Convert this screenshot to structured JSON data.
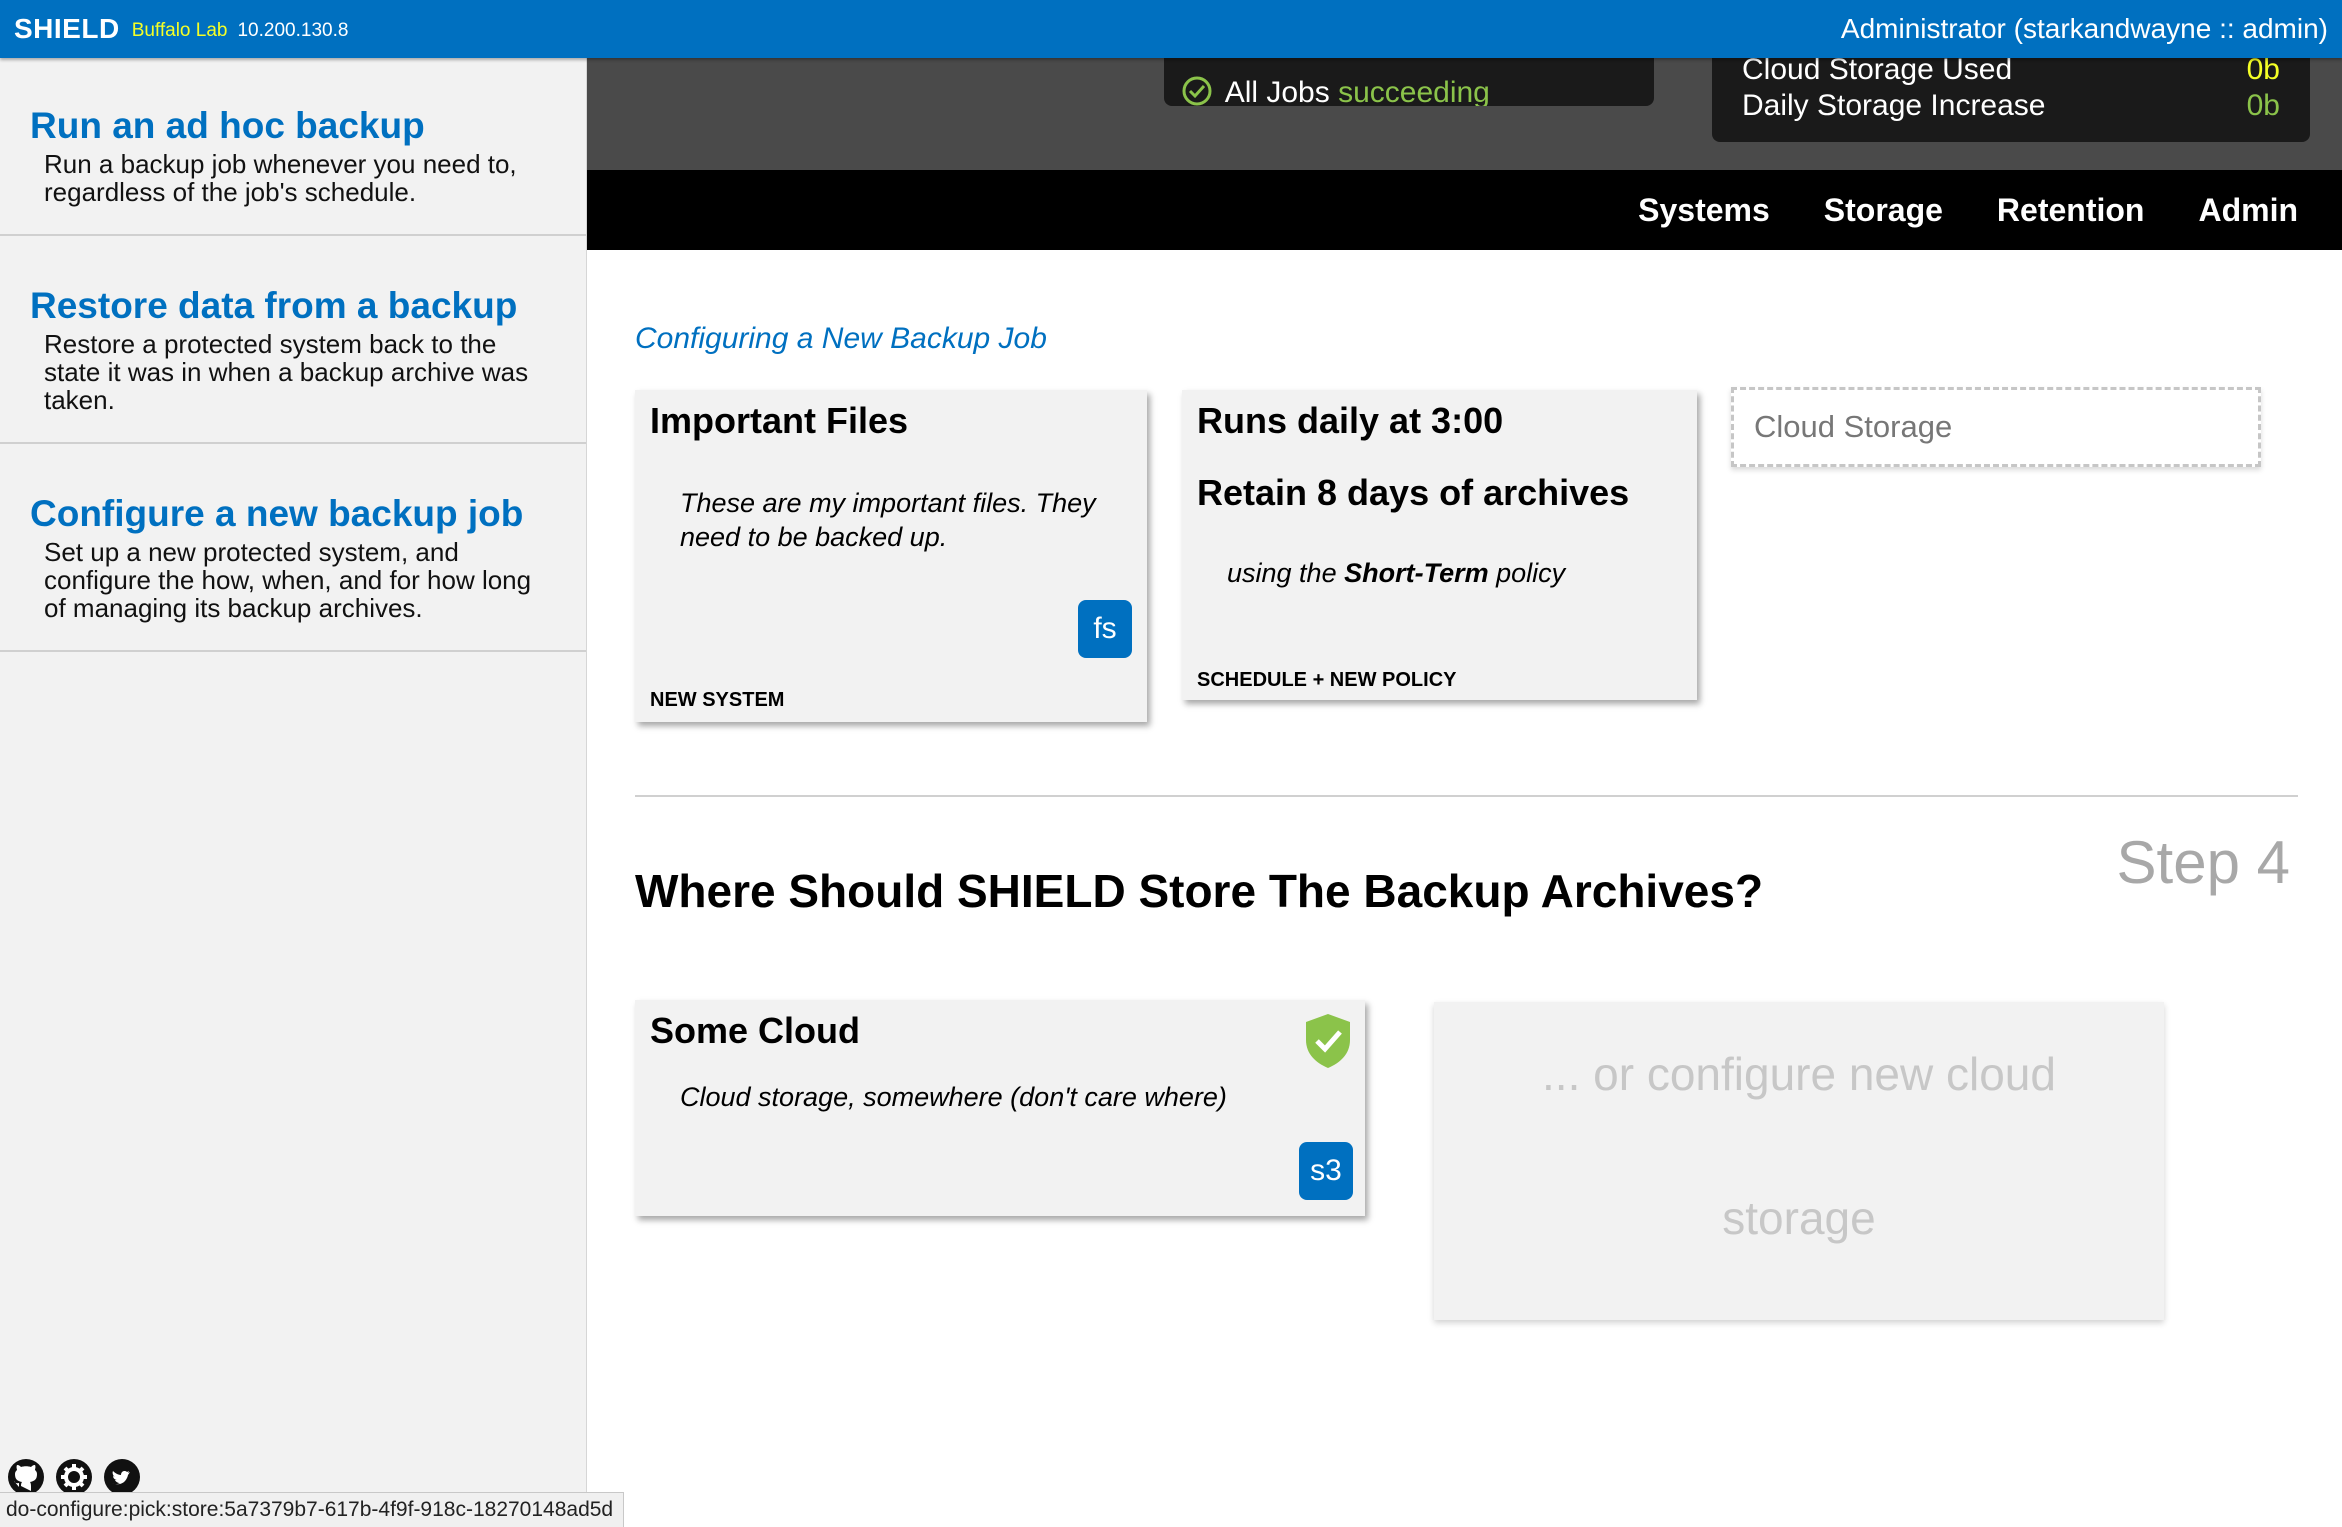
{
  "topbar": {
    "brand": "SHIELD",
    "env": "Buffalo Lab",
    "ip": "10.200.130.8",
    "user": "Administrator (starkandwayne :: admin)"
  },
  "sidebar": {
    "items": [
      {
        "title": "Run an ad hoc backup",
        "desc": "Run a backup job whenever you need to, regardless of the job's schedule."
      },
      {
        "title": "Restore data from a backup",
        "desc": "Restore a protected system back to the state it was in when a backup archive was taken."
      },
      {
        "title": "Configure a new backup job",
        "desc": "Set up a new protected system, and configure the how, when, and for how long of managing its backup archives."
      }
    ],
    "footer_icons": [
      "github-icon",
      "gear-icon",
      "twitter-icon"
    ]
  },
  "dashboard": {
    "jobs_label": "All Jobs",
    "jobs_status": "succeeding",
    "cloud_used_label": "Cloud Storage Used",
    "cloud_used_value": "0b",
    "daily_increase_label": "Daily Storage Increase",
    "daily_increase_value": "0b"
  },
  "nav": {
    "items": [
      "Systems",
      "Storage",
      "Retention",
      "Admin"
    ]
  },
  "main": {
    "breadcrumb": "Configuring a New Backup Job",
    "system_card": {
      "title": "Important Files",
      "desc": "These are my important files. They need to be backed up.",
      "badge": "fs",
      "caption": "NEW SYSTEM"
    },
    "schedule_card": {
      "title": "Runs daily at 3:00",
      "retain": "Retain 8 days of archives",
      "policy_prefix": "using the",
      "policy_name": "Short-Term",
      "policy_suffix": "policy",
      "caption": "SCHEDULE + NEW POLICY"
    },
    "store_placeholder": "Cloud Storage",
    "step": "Step 4",
    "question": "Where Should SHIELD Store The Backup Archives?",
    "cloud_card": {
      "title": "Some Cloud",
      "desc": "Cloud storage, somewhere (don't care where)",
      "badge": "s3"
    },
    "new_cloud": {
      "line1": "... or configure new cloud",
      "line2": "storage"
    }
  },
  "statusline": "do-configure:pick:store:5a7379b7-617b-4f9f-918c-18270148ad5d",
  "colors": {
    "brand_blue": "#0070c0",
    "accent_yellow": "#f5ff26",
    "success_green": "#8bc34a"
  }
}
